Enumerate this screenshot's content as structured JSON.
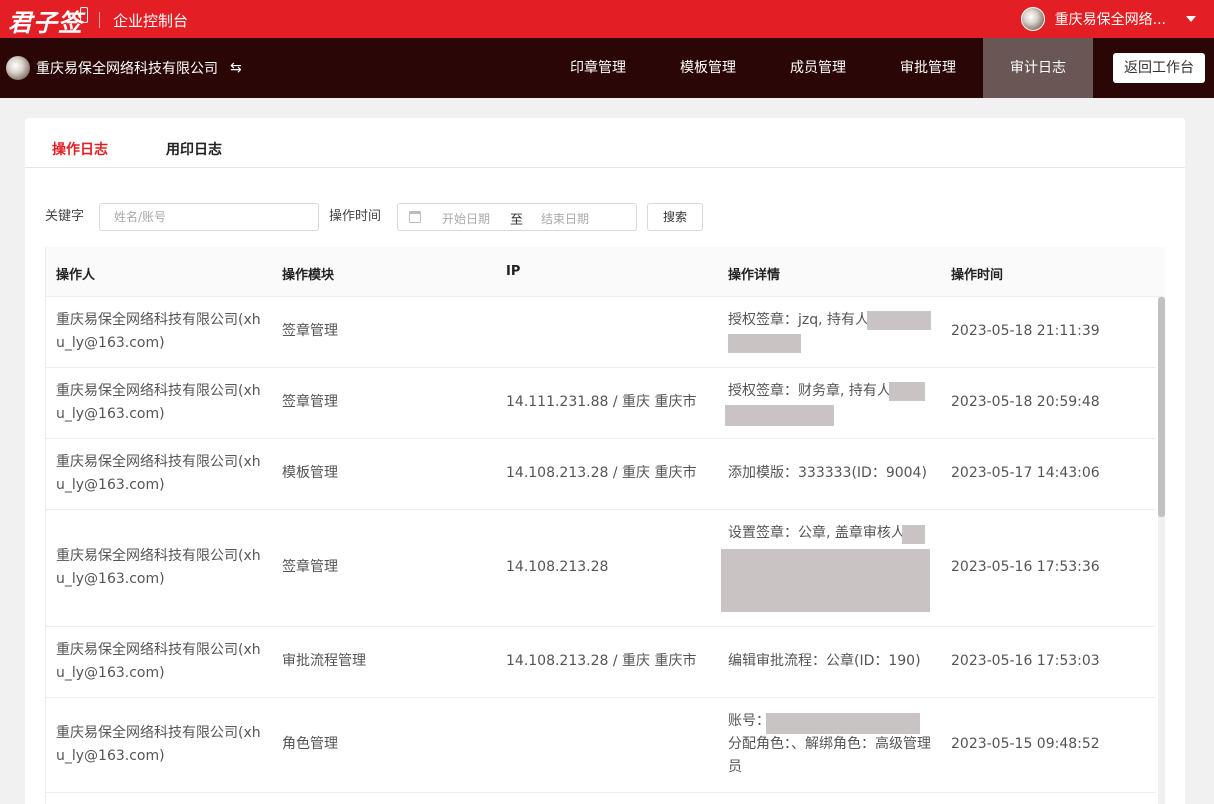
{
  "brand": {
    "logo_text": "君子签",
    "console_title": "企业控制台"
  },
  "user": {
    "name": "重庆易保全网络..."
  },
  "navbar": {
    "company_name": "重庆易保全网络科技有限公司",
    "swap_glyph": "⇆",
    "items": [
      "印章管理",
      "模板管理",
      "成员管理",
      "审批管理",
      "审计日志"
    ],
    "active_item": "审计日志",
    "back_label": "返回工作台"
  },
  "tabs": [
    {
      "label": "操作日志",
      "active": true
    },
    {
      "label": "用印日志",
      "active": false
    }
  ],
  "filters": {
    "keyword_label": "关键字",
    "keyword_placeholder": "姓名/账号",
    "time_label": "操作时间",
    "start_placeholder": "开始日期",
    "range_separator": "至",
    "end_placeholder": "结束日期",
    "search_label": "搜索"
  },
  "table": {
    "columns": [
      "操作人",
      "操作模块",
      "IP",
      "操作详情",
      "操作时间"
    ],
    "rows": [
      {
        "operator": "重庆易保全网络科技有限公司(xhu_ly@163.com)",
        "module": "签章管理",
        "ip": "",
        "detail": "授权签章：jzq, 持有人",
        "time": "2023-05-18 21:11:39"
      },
      {
        "operator": "重庆易保全网络科技有限公司(xhu_ly@163.com)",
        "module": "签章管理",
        "ip": "14.111.231.88 / 重庆 重庆市",
        "detail": "授权签章：财务章, 持有人",
        "time": "2023-05-18 20:59:48"
      },
      {
        "operator": "重庆易保全网络科技有限公司(xhu_ly@163.com)",
        "module": "模板管理",
        "ip": "14.108.213.28 / 重庆 重庆市",
        "detail": "添加模版：333333(ID：9004)",
        "time": "2023-05-17 14:43:06"
      },
      {
        "operator": "重庆易保全网络科技有限公司(xhu_ly@163.com)",
        "module": "签章管理",
        "ip": "14.108.213.28",
        "detail": "设置签章：公章, 盖章审核人",
        "time": "2023-05-16 17:53:36"
      },
      {
        "operator": "重庆易保全网络科技有限公司(xhu_ly@163.com)",
        "module": "审批流程管理",
        "ip": "14.108.213.28 / 重庆 重庆市",
        "detail": "编辑审批流程：公章(ID：190)",
        "time": "2023-05-16 17:53:03"
      },
      {
        "operator": "重庆易保全网络科技有限公司(xhu_ly@163.com)",
        "module": "角色管理",
        "ip": "",
        "detail_line1": "账号：",
        "detail_line2": "分配角色：、解绑角色：高级管理员",
        "time": "2023-05-15 09:48:52"
      }
    ]
  }
}
